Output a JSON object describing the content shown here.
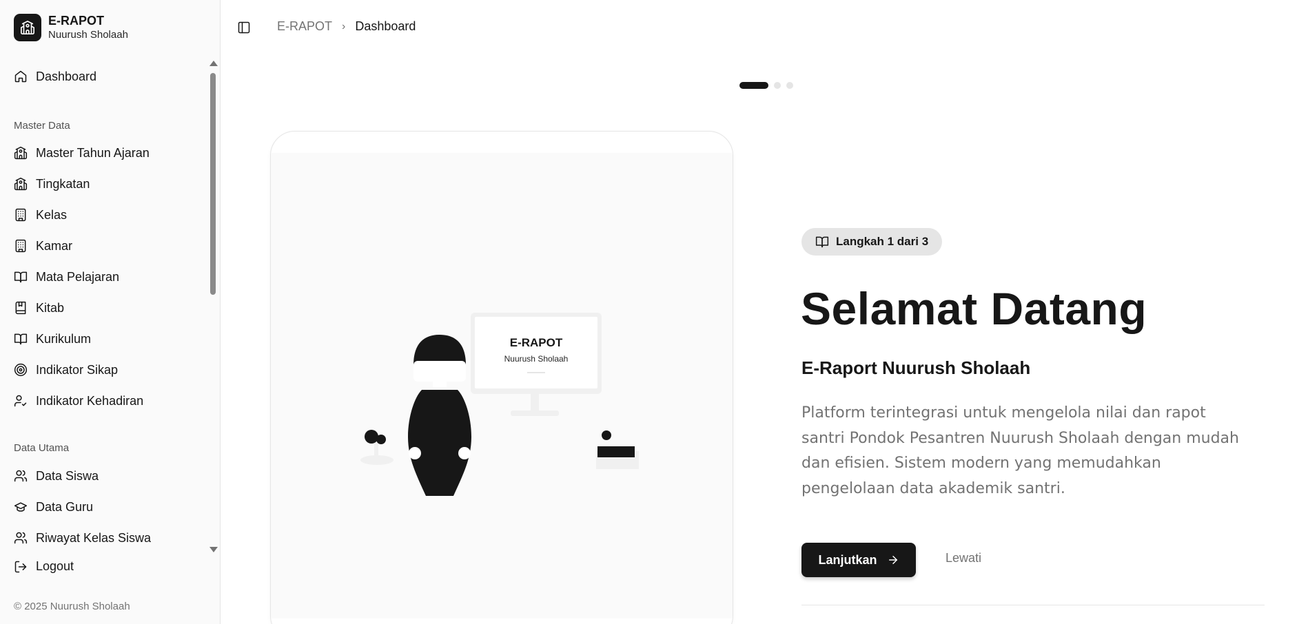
{
  "brand": {
    "title": "E-RAPOT",
    "subtitle": "Nuurush Sholaah"
  },
  "sidebar": {
    "dashboard": "Dashboard",
    "master_label": "Master Data",
    "master_items": [
      {
        "label": "Master Tahun Ajaran",
        "icon": "school-icon"
      },
      {
        "label": "Tingkatan",
        "icon": "school-icon"
      },
      {
        "label": "Kelas",
        "icon": "building-icon"
      },
      {
        "label": "Kamar",
        "icon": "building-icon"
      },
      {
        "label": "Mata Pelajaran",
        "icon": "book-open-icon"
      },
      {
        "label": "Kitab",
        "icon": "book-icon"
      },
      {
        "label": "Kurikulum",
        "icon": "book-open-icon"
      },
      {
        "label": "Indikator Sikap",
        "icon": "target-icon"
      },
      {
        "label": "Indikator Kehadiran",
        "icon": "user-check-icon"
      }
    ],
    "utama_label": "Data Utama",
    "utama_items": [
      {
        "label": "Data Siswa",
        "icon": "users-icon"
      },
      {
        "label": "Data Guru",
        "icon": "graduation-cap-icon"
      },
      {
        "label": "Riwayat Kelas Siswa",
        "icon": "users-icon"
      }
    ],
    "logout": "Logout",
    "footer": "© 2025 Nuurush Sholaah"
  },
  "breadcrumb": {
    "root": "E-RAPOT",
    "separator": "›",
    "current": "Dashboard"
  },
  "stepper": {
    "total": 3,
    "active": 1
  },
  "illustration": {
    "screen_title": "E-RAPOT",
    "screen_subtitle": "Nuurush Sholaah"
  },
  "content": {
    "step_badge": "Langkah 1 dari 3",
    "title": "Selamat Datang",
    "subtitle": "E-Raport Nuurush Sholaah",
    "description": "Platform terintegrasi untuk mengelola nilai dan rapot santri Pondok Pesantren Nuurush Sholaah dengan mudah dan efisien. Sistem modern yang memudahkan pengelolaan data akademik santri.",
    "continue_label": "Lanjutkan",
    "skip_label": "Lewati"
  },
  "colors": {
    "primary": "#171717",
    "muted": "#737373",
    "border": "#e5e5e5",
    "sidebar_bg": "#fafafa"
  }
}
